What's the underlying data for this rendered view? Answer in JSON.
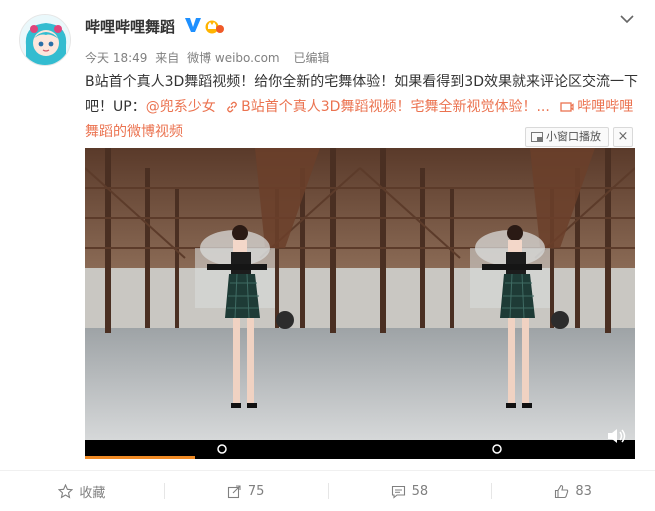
{
  "user": {
    "name": "哔哩哔哩舞蹈",
    "verified_icon": "v-verified-icon",
    "vip_icon": "vip-crown-icon"
  },
  "meta": {
    "time": "今天 18:49",
    "from": "来自",
    "source": "微博 weibo.com",
    "edited": "已编辑"
  },
  "post": {
    "text_part1": "B站首个真人3D舞蹈视频！给你全新的宅舞体验！如果看得到3D效果就来评论区交流一下吧！UP：",
    "mention": "@兜系少女",
    "link_text": "B站首个真人3D舞蹈视频！宅舞全新视觉体验！...",
    "video_link": "哔哩哔哩舞蹈的微博视频"
  },
  "video": {
    "mini_window_label": "小窗口播放",
    "close_label": "×",
    "progress_fraction": 0.2
  },
  "actions": [
    {
      "name": "favorite",
      "label": "收藏",
      "icon": "star-icon"
    },
    {
      "name": "repost",
      "label": "75",
      "icon": "share-icon"
    },
    {
      "name": "comment",
      "label": "58",
      "icon": "comment-icon"
    },
    {
      "name": "like",
      "label": "83",
      "icon": "thumbs-up-icon"
    }
  ],
  "colors": {
    "link": "#eb7350",
    "progress": "#f08a24",
    "verified": "#1e90ff"
  }
}
